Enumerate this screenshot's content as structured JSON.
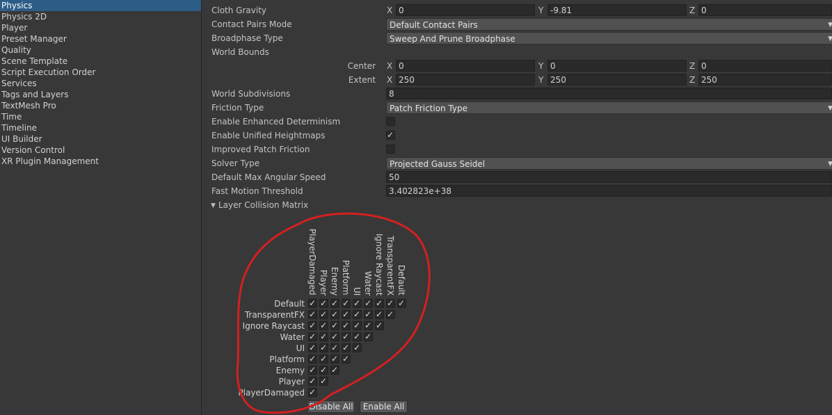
{
  "sidebar": {
    "items": [
      {
        "label": "Physics",
        "selected": true
      },
      {
        "label": "Physics 2D"
      },
      {
        "label": "Player"
      },
      {
        "label": "Preset Manager"
      },
      {
        "label": "Quality"
      },
      {
        "label": "Scene Template"
      },
      {
        "label": "Script Execution Order"
      },
      {
        "label": "Services"
      },
      {
        "label": "Tags and Layers"
      },
      {
        "label": "TextMesh Pro"
      },
      {
        "label": "Time"
      },
      {
        "label": "Timeline"
      },
      {
        "label": "UI Builder"
      },
      {
        "label": "Version Control"
      },
      {
        "label": "XR Plugin Management"
      }
    ]
  },
  "settings": {
    "cloth_gravity": {
      "label": "Cloth Gravity",
      "x_label": "X",
      "x": "0",
      "y_label": "Y",
      "y": "-9.81",
      "z_label": "Z",
      "z": "0"
    },
    "contact_pairs_mode": {
      "label": "Contact Pairs Mode",
      "value": "Default Contact Pairs"
    },
    "broadphase_type": {
      "label": "Broadphase Type",
      "value": "Sweep And Prune Broadphase"
    },
    "world_bounds": {
      "label": "World Bounds"
    },
    "center": {
      "label": "Center",
      "x_label": "X",
      "x": "0",
      "y_label": "Y",
      "y": "0",
      "z_label": "Z",
      "z": "0"
    },
    "extent": {
      "label": "Extent",
      "x_label": "X",
      "x": "250",
      "y_label": "Y",
      "y": "250",
      "z_label": "Z",
      "z": "250"
    },
    "world_subdivisions": {
      "label": "World Subdivisions",
      "value": "8"
    },
    "friction_type": {
      "label": "Friction Type",
      "value": "Patch Friction Type"
    },
    "enhanced_determinism": {
      "label": "Enable Enhanced Determinism",
      "checked": false
    },
    "unified_heightmaps": {
      "label": "Enable Unified Heightmaps",
      "checked": true
    },
    "improved_patch_friction": {
      "label": "Improved Patch Friction",
      "checked": false
    },
    "solver_type": {
      "label": "Solver Type",
      "value": "Projected Gauss Seidel"
    },
    "max_angular_speed": {
      "label": "Default Max Angular Speed",
      "value": "50"
    },
    "fast_motion_threshold": {
      "label": "Fast Motion Threshold",
      "value": "3.402823e+38"
    }
  },
  "matrix": {
    "title": "Layer Collision Matrix",
    "layers": [
      "Default",
      "TransparentFX",
      "Ignore Raycast",
      "Water",
      "UI",
      "Platform",
      "Enemy",
      "Player",
      "PlayerDamaged"
    ],
    "disable_all": "Disable All",
    "enable_all": "Enable All"
  },
  "icons": {
    "check": "checkmark-icon",
    "dropdown": "chevron-down-icon",
    "foldout": "foldout-arrow-icon"
  },
  "colors": {
    "selection": "#2c5d87",
    "annotation": "#d42020",
    "panel": "#383838"
  }
}
